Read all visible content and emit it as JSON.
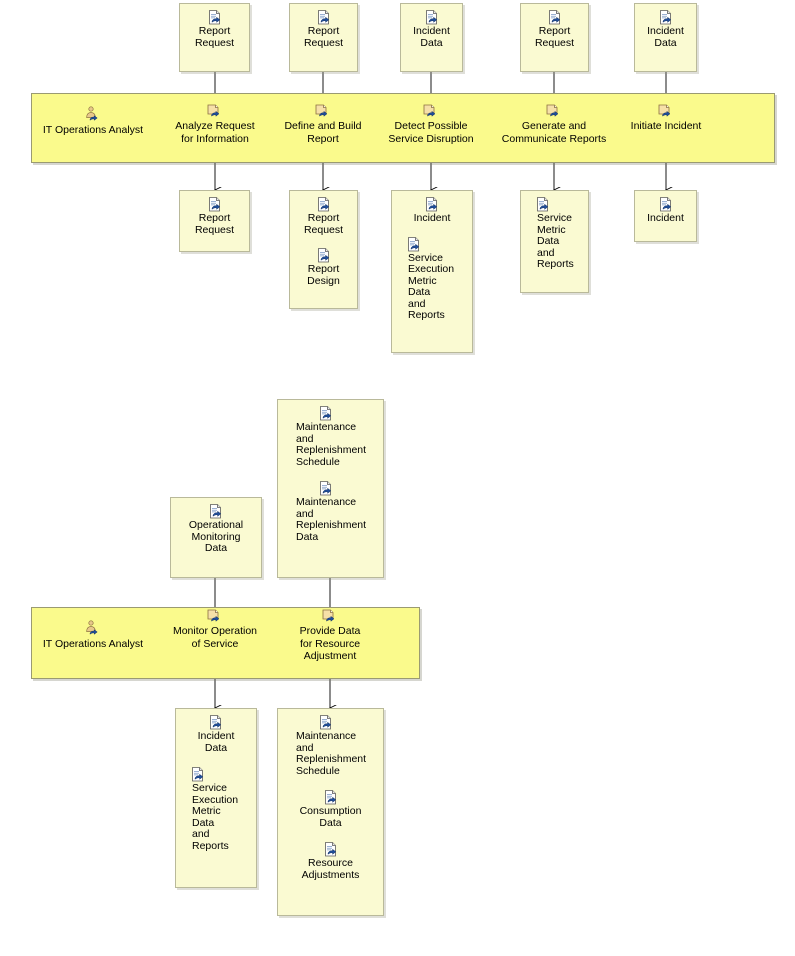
{
  "diagram": {
    "title": "IT Operations Analyst activity diagram",
    "colors": {
      "swimlane_fill": "#fafa8c",
      "swimlane_border": "#9a9a72",
      "artifact_fill": "#fafad2",
      "artifact_border": "#b9b99a",
      "connector": "#000000",
      "icon_blue": "#1f4e9c",
      "icon_tan": "#f0d090"
    },
    "icons": {
      "artifact": "work-product-icon",
      "task": "task-icon",
      "role": "role-icon"
    },
    "sections": [
      {
        "id": "section-1",
        "role": {
          "label": "IT Operations Analyst",
          "icon": "role-icon"
        },
        "inputs": [
          {
            "id": "in-1-1",
            "items": [
              {
                "label": "Report\nRequest",
                "icon": "work-product-icon"
              }
            ]
          },
          {
            "id": "in-1-2",
            "items": [
              {
                "label": "Report\nRequest",
                "icon": "work-product-icon"
              }
            ]
          },
          {
            "id": "in-1-3",
            "items": [
              {
                "label": "Incident\nData",
                "icon": "work-product-icon"
              }
            ]
          },
          {
            "id": "in-1-4",
            "items": [
              {
                "label": "Report\nRequest",
                "icon": "work-product-icon"
              }
            ]
          },
          {
            "id": "in-1-5",
            "items": [
              {
                "label": "Incident\nData",
                "icon": "work-product-icon"
              }
            ]
          }
        ],
        "tasks": [
          {
            "id": "task-1-1",
            "label": "Analyze Request\nfor Information",
            "icon": "task-icon"
          },
          {
            "id": "task-1-2",
            "label": "Define and Build\nReport",
            "icon": "task-icon"
          },
          {
            "id": "task-1-3",
            "label": "Detect Possible\nService Disruption",
            "icon": "task-icon"
          },
          {
            "id": "task-1-4",
            "label": "Generate and\nCommunicate Reports",
            "icon": "task-icon"
          },
          {
            "id": "task-1-5",
            "label": "Initiate Incident",
            "icon": "task-icon"
          }
        ],
        "outputs": [
          {
            "id": "out-1-1",
            "items": [
              {
                "label": "Report\nRequest",
                "icon": "work-product-icon"
              }
            ]
          },
          {
            "id": "out-1-2",
            "items": [
              {
                "label": "Report\nRequest",
                "icon": "work-product-icon"
              },
              {
                "label": "Report\nDesign",
                "icon": "work-product-icon"
              }
            ]
          },
          {
            "id": "out-1-3",
            "items": [
              {
                "label": "Incident",
                "icon": "work-product-icon"
              },
              {
                "label": "Service\nExecution\nMetric\nData\nand\nReports",
                "icon": "work-product-icon"
              }
            ]
          },
          {
            "id": "out-1-4",
            "items": [
              {
                "label": "Service\nMetric\nData\nand\nReports",
                "icon": "work-product-icon"
              }
            ]
          },
          {
            "id": "out-1-5",
            "items": [
              {
                "label": "Incident",
                "icon": "work-product-icon"
              }
            ]
          }
        ]
      },
      {
        "id": "section-2",
        "role": {
          "label": "IT Operations Analyst",
          "icon": "role-icon"
        },
        "inputs": [
          {
            "id": "in-2-1",
            "items": [
              {
                "label": "Operational\nMonitoring\nData",
                "icon": "work-product-icon"
              }
            ]
          },
          {
            "id": "in-2-2",
            "items": [
              {
                "label": "Maintenance\nand\nReplenishment\nSchedule",
                "icon": "work-product-icon"
              },
              {
                "label": "Maintenance\nand\nReplenishment\nData",
                "icon": "work-product-icon"
              }
            ]
          }
        ],
        "tasks": [
          {
            "id": "task-2-1",
            "label": "Monitor Operation\nof Service",
            "icon": "task-icon"
          },
          {
            "id": "task-2-2",
            "label": "Provide Data\nfor Resource\nAdjustment",
            "icon": "task-icon"
          }
        ],
        "outputs": [
          {
            "id": "out-2-1",
            "items": [
              {
                "label": "Incident\nData",
                "icon": "work-product-icon"
              },
              {
                "label": "Service\nExecution\nMetric\nData\nand\nReports",
                "icon": "work-product-icon"
              }
            ]
          },
          {
            "id": "out-2-2",
            "items": [
              {
                "label": "Maintenance\nand\nReplenishment\nSchedule",
                "icon": "work-product-icon"
              },
              {
                "label": "Consumption\nData",
                "icon": "work-product-icon"
              },
              {
                "label": "Resource\nAdjustments",
                "icon": "work-product-icon"
              }
            ]
          }
        ]
      }
    ]
  }
}
